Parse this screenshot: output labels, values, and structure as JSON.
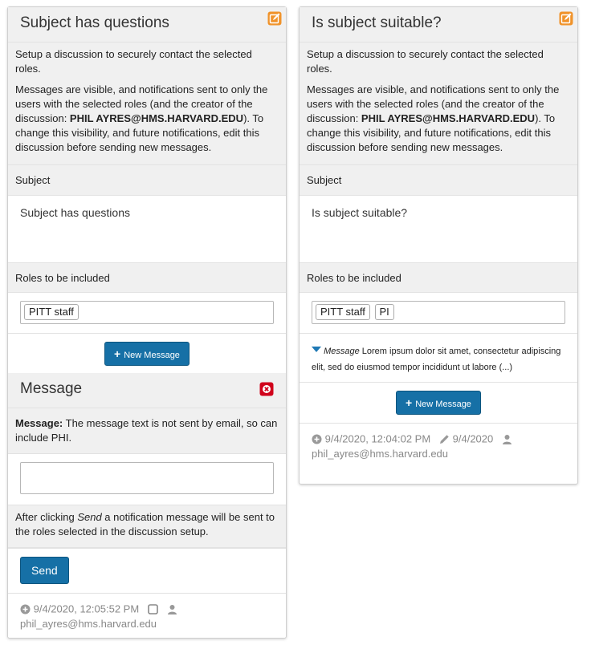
{
  "left_card": {
    "title": "Subject has questions",
    "info_p1": "Setup a discussion to securely contact the selected roles.",
    "info_p2_prefix": "Messages are visible, and notifications sent to only the users with the selected roles (and the creator of the discussion: ",
    "creator": "PHIL AYRES@HMS.HARVARD.EDU",
    "info_p2_suffix": "). To change this visibility, and future notifications, edit this discussion before sending new messages.",
    "subject_label": "Subject",
    "subject_value": "Subject has questions",
    "roles_label": "Roles to be included",
    "roles": [
      "PITT staff"
    ],
    "new_message_label": "New Message",
    "message_section": {
      "title": "Message",
      "note_bold": "Message:",
      "note_text": " The message text is not sent by email, so can include PHI.",
      "message_value": "",
      "after_prefix": "After clicking ",
      "after_em": "Send",
      "after_suffix": " a notification message will be sent to the roles selected in the discussion setup.",
      "send_label": "Send"
    },
    "footer": {
      "created": "9/4/2020, 12:05:52 PM",
      "user": "phil_ayres@hms.harvard.edu"
    }
  },
  "right_card": {
    "title": "Is subject suitable?",
    "info_p1": "Setup a discussion to securely contact the selected roles.",
    "info_p2_prefix": "Messages are visible, and notifications sent to only the users with the selected roles (and the creator of the discussion: ",
    "creator": "PHIL AYRES@HMS.HARVARD.EDU",
    "info_p2_suffix": "). To change this visibility, and future notifications, edit this discussion before sending new messages.",
    "subject_label": "Subject",
    "subject_value": "Is subject suitable?",
    "roles_label": "Roles to be included",
    "roles": [
      "PITT staff",
      "PI"
    ],
    "message_preview": {
      "label": "Message",
      "text": " Lorem ipsum dolor sit amet, consectetur adipiscing elit, sed do eiusmod tempor incididunt ut labore (...)"
    },
    "new_message_label": "New Message",
    "footer": {
      "created": "9/4/2020, 12:04:02 PM",
      "edited": "9/4/2020",
      "user": "phil_ayres@hms.harvard.edu"
    }
  },
  "colors": {
    "edit_icon": "#f0932b",
    "remove_icon": "#d0021b",
    "primary_button": "#1670a6",
    "triangle": "#1f79b5"
  }
}
